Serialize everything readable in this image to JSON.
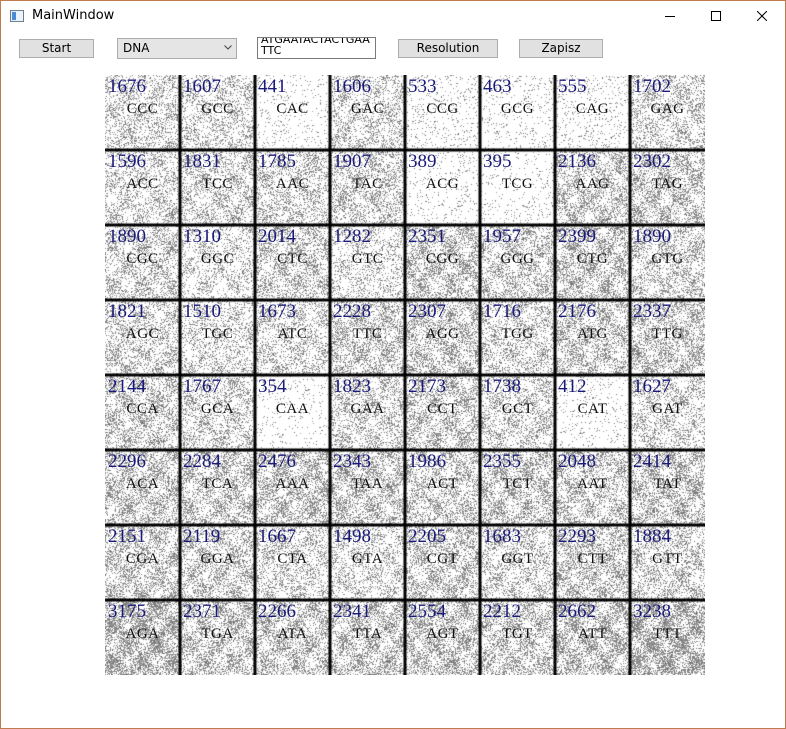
{
  "window": {
    "title": "MainWindow"
  },
  "toolbar": {
    "start_label": "Start",
    "mode_value": "DNA",
    "sequence_value": "ATGAATACTACTGAATTC",
    "resolution_label": "Resolution",
    "save_label": "Zapisz"
  },
  "grid": {
    "rows": 8,
    "cols": 8,
    "cells": [
      {
        "codon": "CCC",
        "count": "1676",
        "density": 0.35
      },
      {
        "codon": "GCC",
        "count": "1607",
        "density": 0.34
      },
      {
        "codon": "CAC",
        "count": "441",
        "density": 0.08
      },
      {
        "codon": "GAC",
        "count": "1606",
        "density": 0.34
      },
      {
        "codon": "CCG",
        "count": "533",
        "density": 0.1
      },
      {
        "codon": "GCG",
        "count": "463",
        "density": 0.09
      },
      {
        "codon": "CAG",
        "count": "555",
        "density": 0.1
      },
      {
        "codon": "GAG",
        "count": "1702",
        "density": 0.36
      },
      {
        "codon": "ACC",
        "count": "1596",
        "density": 0.34
      },
      {
        "codon": "TCC",
        "count": "1831",
        "density": 0.39
      },
      {
        "codon": "AAC",
        "count": "1785",
        "density": 0.38
      },
      {
        "codon": "TAC",
        "count": "1907",
        "density": 0.4
      },
      {
        "codon": "ACG",
        "count": "389",
        "density": 0.07
      },
      {
        "codon": "TCG",
        "count": "395",
        "density": 0.07
      },
      {
        "codon": "AAG",
        "count": "2136",
        "density": 0.45
      },
      {
        "codon": "TAG",
        "count": "2302",
        "density": 0.49
      },
      {
        "codon": "CGC",
        "count": "1890",
        "density": 0.4
      },
      {
        "codon": "GGC",
        "count": "1310",
        "density": 0.28
      },
      {
        "codon": "CTC",
        "count": "2014",
        "density": 0.43
      },
      {
        "codon": "GTC",
        "count": "1282",
        "density": 0.27
      },
      {
        "codon": "CGG",
        "count": "2351",
        "density": 0.5
      },
      {
        "codon": "GGG",
        "count": "1957",
        "density": 0.41
      },
      {
        "codon": "CTG",
        "count": "2399",
        "density": 0.51
      },
      {
        "codon": "GTG",
        "count": "1890",
        "density": 0.4
      },
      {
        "codon": "AGC",
        "count": "1821",
        "density": 0.38
      },
      {
        "codon": "TGC",
        "count": "1510",
        "density": 0.32
      },
      {
        "codon": "ATC",
        "count": "1673",
        "density": 0.35
      },
      {
        "codon": "TTC",
        "count": "2228",
        "density": 0.47
      },
      {
        "codon": "AGG",
        "count": "2307",
        "density": 0.49
      },
      {
        "codon": "TGG",
        "count": "1716",
        "density": 0.36
      },
      {
        "codon": "ATG",
        "count": "2176",
        "density": 0.46
      },
      {
        "codon": "TTG",
        "count": "2337",
        "density": 0.49
      },
      {
        "codon": "CCA",
        "count": "2144",
        "density": 0.45
      },
      {
        "codon": "GCA",
        "count": "1767",
        "density": 0.37
      },
      {
        "codon": "CAA",
        "count": "354",
        "density": 0.06
      },
      {
        "codon": "GAA",
        "count": "1823",
        "density": 0.39
      },
      {
        "codon": "CCT",
        "count": "2173",
        "density": 0.46
      },
      {
        "codon": "GCT",
        "count": "1738",
        "density": 0.37
      },
      {
        "codon": "CAT",
        "count": "412",
        "density": 0.07
      },
      {
        "codon": "GAT",
        "count": "1627",
        "density": 0.34
      },
      {
        "codon": "ACA",
        "count": "2296",
        "density": 0.49
      },
      {
        "codon": "TCA",
        "count": "2284",
        "density": 0.48
      },
      {
        "codon": "AAA",
        "count": "2476",
        "density": 0.52
      },
      {
        "codon": "TAA",
        "count": "2343",
        "density": 0.5
      },
      {
        "codon": "ACT",
        "count": "1986",
        "density": 0.42
      },
      {
        "codon": "TCT",
        "count": "2355",
        "density": 0.5
      },
      {
        "codon": "AAT",
        "count": "2048",
        "density": 0.43
      },
      {
        "codon": "TAT",
        "count": "2414",
        "density": 0.51
      },
      {
        "codon": "CGA",
        "count": "2151",
        "density": 0.46
      },
      {
        "codon": "GGA",
        "count": "2119",
        "density": 0.45
      },
      {
        "codon": "CTA",
        "count": "1667",
        "density": 0.35
      },
      {
        "codon": "GTA",
        "count": "1498",
        "density": 0.32
      },
      {
        "codon": "CGT",
        "count": "2205",
        "density": 0.47
      },
      {
        "codon": "GGT",
        "count": "1683",
        "density": 0.36
      },
      {
        "codon": "CTT",
        "count": "2293",
        "density": 0.49
      },
      {
        "codon": "GTT",
        "count": "1884",
        "density": 0.4
      },
      {
        "codon": "AGA",
        "count": "3175",
        "density": 0.67
      },
      {
        "codon": "TGA",
        "count": "2371",
        "density": 0.5
      },
      {
        "codon": "ATA",
        "count": "2266",
        "density": 0.48
      },
      {
        "codon": "TTA",
        "count": "2341",
        "density": 0.5
      },
      {
        "codon": "AGT",
        "count": "2554",
        "density": 0.54
      },
      {
        "codon": "TGT",
        "count": "2212",
        "density": 0.47
      },
      {
        "codon": "ATT",
        "count": "2662",
        "density": 0.56
      },
      {
        "codon": "TTT",
        "count": "3238",
        "density": 0.68
      }
    ]
  },
  "colors": {
    "count_text": "#1a1a7a",
    "grid_line": "#000000",
    "dot": "#8a8a8a"
  }
}
